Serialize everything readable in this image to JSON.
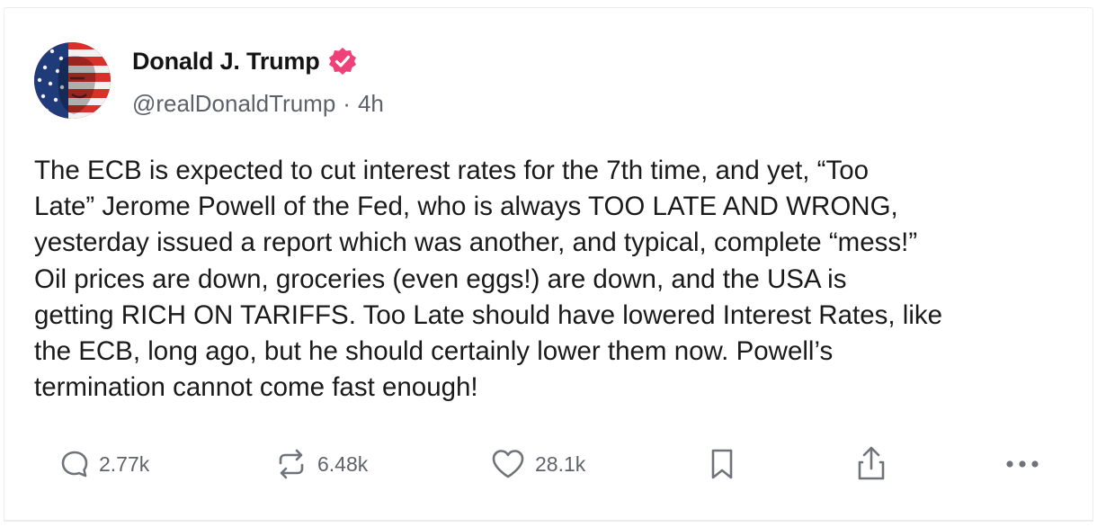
{
  "post": {
    "author": {
      "display_name": "Donald J. Trump",
      "handle": "@realDonaldTrump",
      "verified": true,
      "badge_color": "#f0407a"
    },
    "separator": "·",
    "time_ago": "4h",
    "text": "The ECB is expected to cut interest rates for the 7th time, and yet, “Too\nLate” Jerome Powell of the Fed, who is always TOO LATE AND WRONG,\nyesterday issued a report which was another, and typical, complete “mess!”\nOil prices are down, groceries (even eggs!) are down, and the USA is\ngetting RICH ON TARIFFS. Too Late should have lowered Interest Rates, like\nthe ECB, long ago, but he should certainly lower them now. Powell’s\ntermination cannot come fast enough!",
    "actions": {
      "replies": "2.77k",
      "retruths": "6.48k",
      "likes": "28.1k"
    },
    "icons": {
      "reply": "speech-bubble-icon",
      "retruth": "repost-arrows-icon",
      "like": "heart-icon",
      "bookmark": "bookmark-icon",
      "share": "share-upload-icon",
      "more": "more-dots-icon"
    }
  }
}
